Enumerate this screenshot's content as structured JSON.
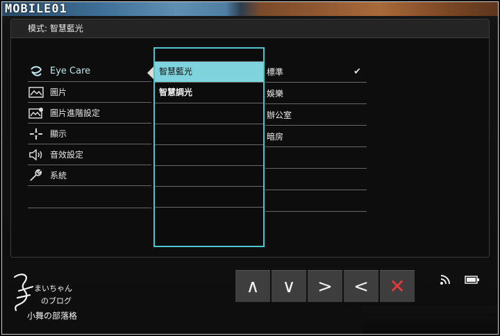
{
  "watermark": "MOBILE01",
  "osd": {
    "header_title": "模式: 智慧藍光",
    "menu": [
      {
        "label": "Eye Care",
        "icon": "eye-care-icon",
        "active": true
      },
      {
        "label": "圖片",
        "icon": "picture-icon"
      },
      {
        "label": "圖片進階設定",
        "icon": "picture-advanced-icon"
      },
      {
        "label": "顯示",
        "icon": "display-icon"
      },
      {
        "label": "音效設定",
        "icon": "audio-icon"
      },
      {
        "label": "系統",
        "icon": "system-icon"
      }
    ],
    "submenu": [
      {
        "label": "智慧藍光",
        "selected": true
      },
      {
        "label": "智慧調光",
        "selected": false
      }
    ],
    "options": [
      {
        "label": "標準",
        "checked": true
      },
      {
        "label": "娛樂",
        "checked": false
      },
      {
        "label": "辦公室",
        "checked": false
      },
      {
        "label": "暗房",
        "checked": false
      }
    ]
  },
  "nav": {
    "up": "∧",
    "down": "∨",
    "right": ">",
    "left": "<",
    "close": "✕"
  },
  "signature": {
    "line1": "まいちゃん",
    "line2": "のブログ",
    "line3": "小舞の部落格"
  },
  "colors": {
    "accent": "#4ec6cf",
    "selected_bg": "#7fd3dc",
    "close": "#e83a3a"
  }
}
